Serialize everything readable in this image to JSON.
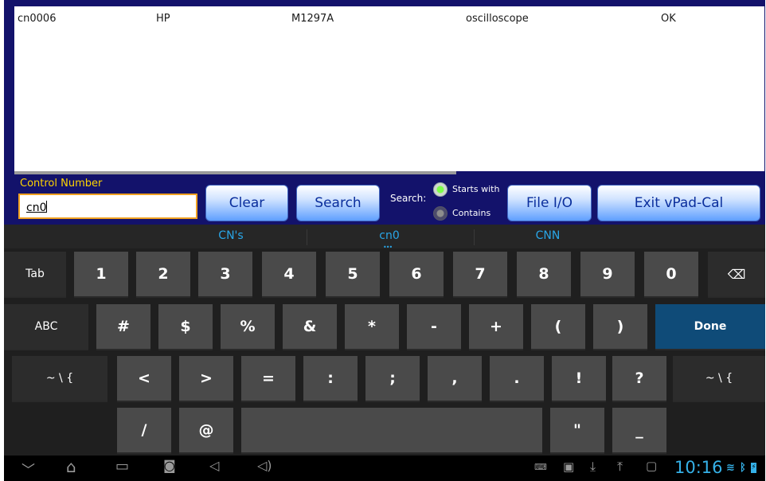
{
  "results": {
    "rows": [
      {
        "control_number": "cn0006",
        "manufacturer": "HP",
        "model": "M1297A",
        "description": "oscilloscope",
        "status": "OK"
      }
    ]
  },
  "search": {
    "field_label": "Control Number",
    "field_value": "cn0",
    "clear_label": "Clear",
    "search_label": "Search",
    "mode_label": "Search:",
    "starts_with_label": "Starts with",
    "contains_label": "Contains",
    "selected_mode": "Starts with",
    "file_io_label": "File I/O",
    "exit_label": "Exit vPad-Cal"
  },
  "keyboard": {
    "suggestions": [
      "CN's",
      "cn0",
      "CNN"
    ],
    "rows": [
      [
        "Tab",
        "1",
        "2",
        "3",
        "4",
        "5",
        "6",
        "7",
        "8",
        "9",
        "0",
        "⌫"
      ],
      [
        "ABC",
        "#",
        "$",
        "%",
        "&",
        "*",
        "-",
        "+",
        "(",
        ")",
        "Done"
      ],
      [
        "~ \\ {",
        "<",
        ">",
        "=",
        ":",
        ";",
        ",",
        ".",
        "!",
        "?",
        "~ \\ {"
      ],
      [
        "/",
        "@",
        "\"",
        "_"
      ]
    ]
  },
  "navbar": {
    "clock": "10:16",
    "icons": [
      "back-icon",
      "home-icon",
      "recent-apps-icon",
      "screenshot-icon",
      "volume-down-icon",
      "volume-up-icon",
      "keyboard-icon",
      "gallery-icon",
      "download-icon",
      "upload-icon",
      "window-icon",
      "wifi-icon",
      "bluetooth-icon",
      "battery-icon"
    ]
  },
  "colors": {
    "app_background": "#13126b",
    "label_yellow": "#ffd400",
    "button_blue": "#5f9fff",
    "accent_blue": "#35b1e8",
    "done_key": "#0f4b78"
  }
}
